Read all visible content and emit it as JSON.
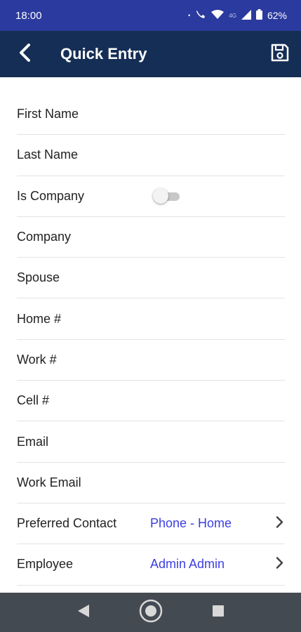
{
  "status_bar": {
    "time": "18:00",
    "dot": "•",
    "lte_label": "4G",
    "battery": "62%"
  },
  "app_bar": {
    "title": "Quick Entry",
    "back_icon": "chevron-left-icon",
    "save_icon": "save-icon"
  },
  "form": {
    "fields": [
      {
        "label": "First Name"
      },
      {
        "label": "Last Name"
      },
      {
        "label": "Is Company",
        "toggle_on": false
      },
      {
        "label": "Company"
      },
      {
        "label": "Spouse"
      },
      {
        "label": "Home #"
      },
      {
        "label": "Work #"
      },
      {
        "label": "Cell #"
      },
      {
        "label": "Email"
      },
      {
        "label": "Work Email"
      },
      {
        "label": "Preferred Contact",
        "value": "Phone - Home"
      },
      {
        "label": "Employee",
        "value": "Admin Admin"
      }
    ]
  },
  "nav_bar": {
    "back_icon": "nav-back-triangle-icon",
    "home_icon": "nav-home-circle-icon",
    "recents_icon": "nav-recents-square-icon"
  },
  "colors": {
    "status_bar_bg": "#2b3a9e",
    "app_bar_bg": "#152e55",
    "value_text": "#3b3fe0",
    "nav_bar_bg": "#444a52"
  }
}
